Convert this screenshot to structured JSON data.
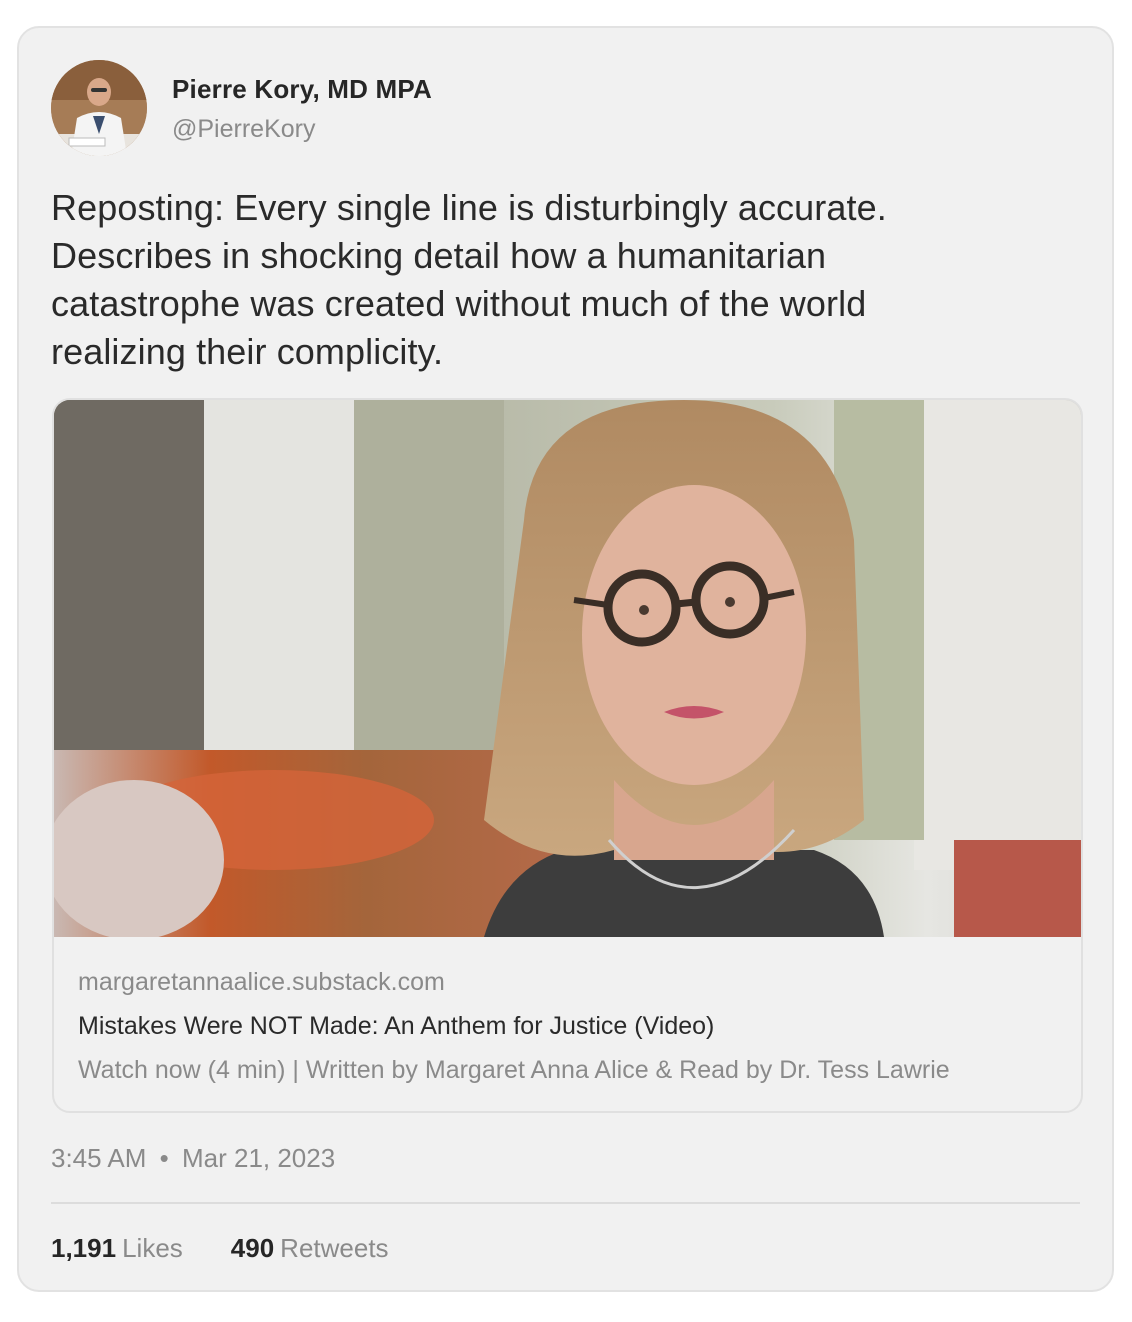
{
  "author": {
    "name": "Pierre Kory, MD MPA",
    "handle": "@PierreKory",
    "avatar_icon": "profile-photo-icon"
  },
  "tweet": {
    "text_lines": [
      "Reposting: Every single line is disturbingly accurate.",
      "Describes in shocking detail how a humanitarian",
      "catastrophe was created without much of the world",
      "realizing their complicity."
    ]
  },
  "link_card": {
    "image_icon": "article-thumbnail-icon",
    "domain": "margaretannaalice.substack.com",
    "title": "Mistakes Were NOT Made: An Anthem for Justice (Video)",
    "description": "Watch now (4 min) | Written by Margaret Anna Alice & Read by Dr. Tess Lawrie"
  },
  "meta": {
    "time": "3:45 AM",
    "separator": "•",
    "date": "Mar 21, 2023"
  },
  "stats": {
    "likes_count": "1,191",
    "likes_label": "Likes",
    "retweets_count": "490",
    "retweets_label": "Retweets"
  },
  "colors": {
    "card_background": "#f1f1f1",
    "card_border": "#e2e2e2",
    "muted_text": "#8a8a8a",
    "primary_text": "#262626"
  }
}
